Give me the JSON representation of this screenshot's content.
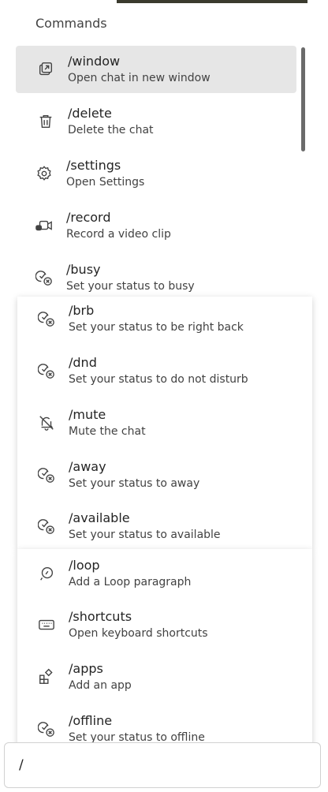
{
  "header": {
    "title": "Commands"
  },
  "commands": [
    {
      "name": "/window",
      "description": "Open chat in new window",
      "icon": "popout-icon",
      "selected": true
    },
    {
      "name": "/delete",
      "description": "Delete the chat",
      "icon": "trash-icon"
    },
    {
      "name": "/settings",
      "description": "Open Settings",
      "icon": "gear-icon"
    },
    {
      "name": "/record",
      "description": "Record a video clip",
      "icon": "video-icon"
    },
    {
      "name": "/busy",
      "description": "Set your status to busy",
      "icon": "status-icon"
    },
    {
      "name": "/brb",
      "description": "Set your status to be right back",
      "icon": "status-icon"
    },
    {
      "name": "/dnd",
      "description": "Set your status to do not disturb",
      "icon": "status-icon"
    },
    {
      "name": "/mute",
      "description": "Mute the chat",
      "icon": "bell-off-icon"
    },
    {
      "name": "/away",
      "description": "Set your status to away",
      "icon": "status-icon"
    },
    {
      "name": "/available",
      "description": "Set your status to available",
      "icon": "status-icon"
    },
    {
      "name": "/loop",
      "description": "Add a Loop paragraph",
      "icon": "loop-icon"
    },
    {
      "name": "/shortcuts",
      "description": "Open keyboard shortcuts",
      "icon": "keyboard-icon"
    },
    {
      "name": "/apps",
      "description": "Add an app",
      "icon": "apps-icon"
    },
    {
      "name": "/offline",
      "description": "Set your status to offline",
      "icon": "status-icon"
    }
  ],
  "composer": {
    "value": "/"
  }
}
